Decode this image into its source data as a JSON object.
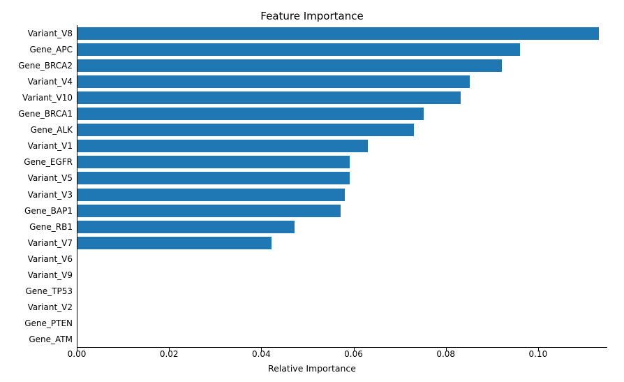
{
  "chart_data": {
    "type": "bar",
    "title": "Feature Importance",
    "xlabel": "Relative Importance",
    "ylabel": "",
    "ylim": null,
    "xlim": [
      0.0,
      0.115
    ],
    "xticks": [
      0.0,
      0.02,
      0.04,
      0.06,
      0.08,
      0.1
    ],
    "xtick_labels": [
      "0.00",
      "0.02",
      "0.04",
      "0.06",
      "0.08",
      "0.10"
    ],
    "categories": [
      "Variant_V8",
      "Gene_APC",
      "Gene_BRCA2",
      "Variant_V4",
      "Variant_V10",
      "Gene_BRCA1",
      "Gene_ALK",
      "Variant_V1",
      "Gene_EGFR",
      "Variant_V5",
      "Variant_V3",
      "Gene_BAP1",
      "Gene_RB1",
      "Variant_V7",
      "Variant_V6",
      "Variant_V9",
      "Gene_TP53",
      "Variant_V2",
      "Gene_PTEN",
      "Gene_ATM"
    ],
    "values": [
      0.113,
      0.096,
      0.092,
      0.085,
      0.083,
      0.075,
      0.073,
      0.063,
      0.059,
      0.059,
      0.058,
      0.057,
      0.047,
      0.042,
      0.0,
      0.0,
      0.0,
      0.0,
      0.0,
      0.0
    ],
    "bar_color": "#1f77b4"
  }
}
